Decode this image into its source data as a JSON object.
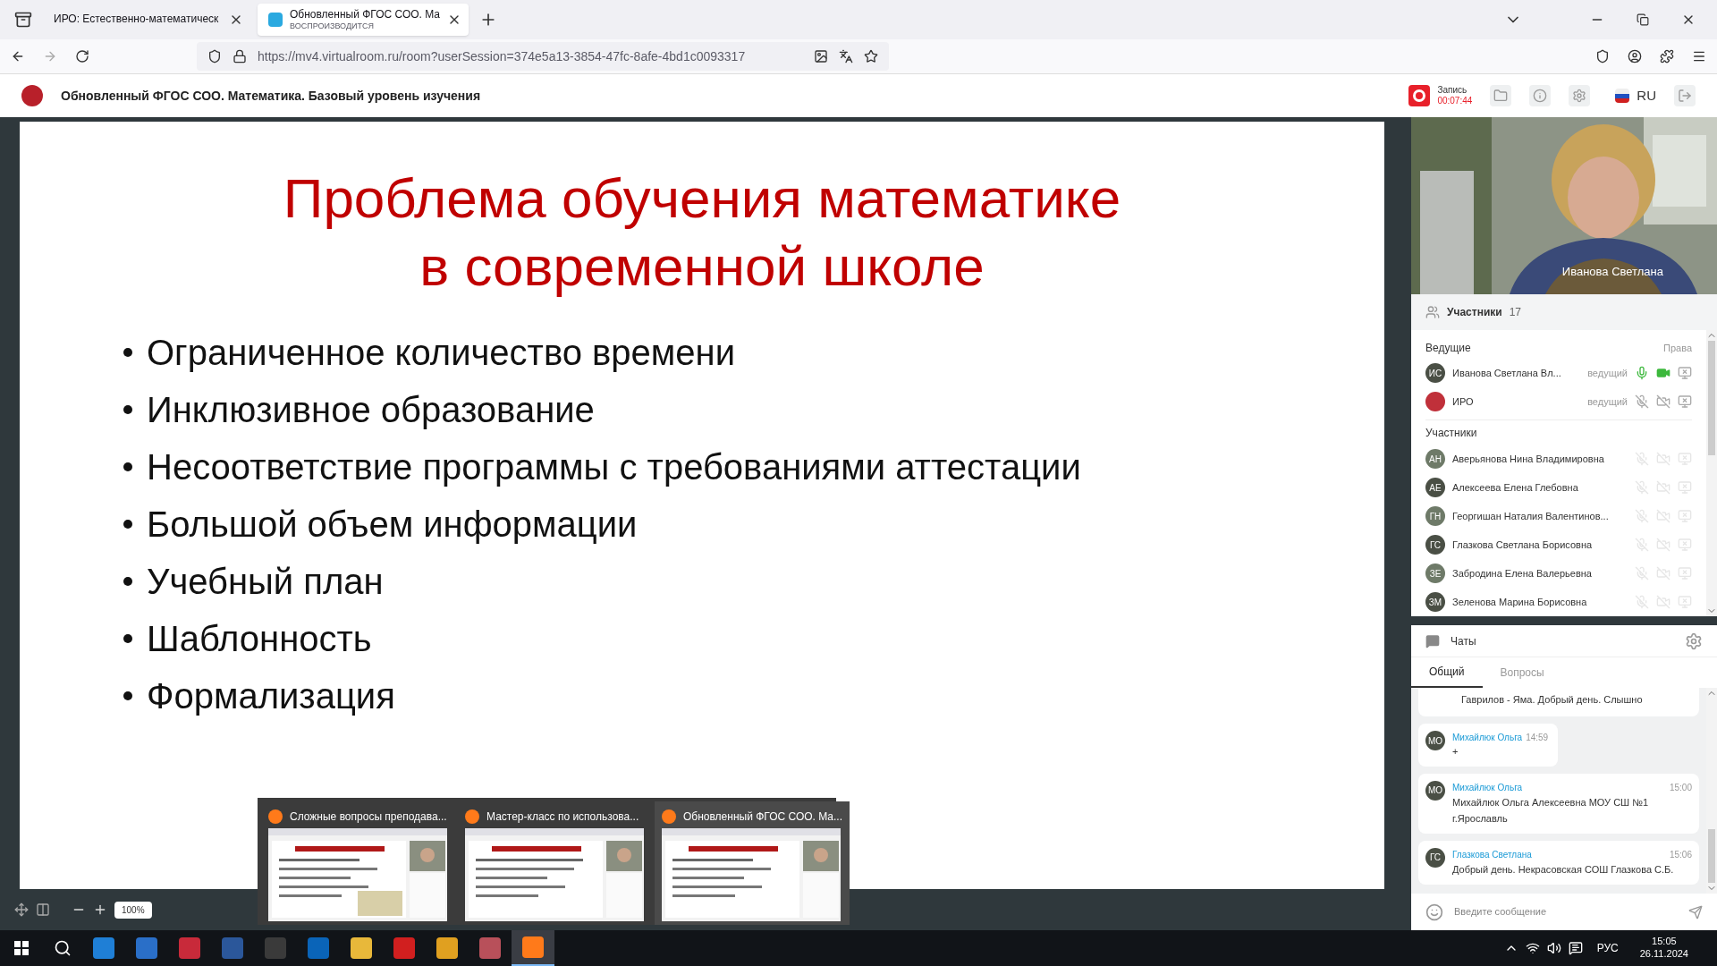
{
  "browser": {
    "tabs": [
      {
        "label": "ИРО: Естественно-математическ",
        "selected": false
      },
      {
        "label": "Обновленный ФГОС СОО. Ма",
        "subtitle": "ВОСПРОИЗВОДИТСЯ",
        "selected": true
      }
    ],
    "url": "https://mv4.virtualroom.ru/room?userSession=374e5a13-3854-47fc-8afe-4bd1c0093317"
  },
  "app_header": {
    "title": "Обновленный ФГОС СОО. Математика. Базовый уровень изучения",
    "record_label": "Запись",
    "record_time": "00:07:44",
    "language": "RU"
  },
  "slide": {
    "title_lines": [
      "Проблема обучения математике",
      "в современной школе"
    ],
    "bullets": [
      "Ограниченное количество времени",
      "Инклюзивное образование",
      "Несоответствие программы с требованиями аттестации",
      "Большой объем информации",
      "Учебный план",
      "Шаблонность",
      "Формализация"
    ]
  },
  "zoom": {
    "value": "100%"
  },
  "window_previews": [
    {
      "title": "Сложные вопросы преподава...",
      "selected": false
    },
    {
      "title": "Мастер-класс по использова...",
      "selected": false
    },
    {
      "title": "Обновленный ФГОС СОО. Ма...",
      "selected": true
    }
  ],
  "video": {
    "name": "Иванова Светлана"
  },
  "participants": {
    "title": "Участники",
    "count": "17",
    "hosts_heading": "Ведущие",
    "rights": "Права",
    "hosts": [
      {
        "kind": "initials",
        "initials": "ИС",
        "name": "Иванова Светлана Вл...",
        "role": "ведущий",
        "mic": true,
        "camera": true
      },
      {
        "kind": "logo",
        "name": "ИРО",
        "role": "ведущий",
        "mic": false,
        "camera": false
      }
    ],
    "members_heading": "Участники",
    "members": [
      {
        "initials": "АН",
        "name": "Аверьянова Нина Владимировна"
      },
      {
        "initials": "АЕ",
        "name": "Алексеева Елена Глебовна"
      },
      {
        "initials": "ГН",
        "name": "Георгишан Наталия Валентинов..."
      },
      {
        "initials": "ГС",
        "name": "Глазкова Светлана Борисовна"
      },
      {
        "initials": "ЗЕ",
        "name": "Забродина Елена Валерьевна"
      },
      {
        "initials": "ЗМ",
        "name": "Зеленова Марина Борисовна"
      }
    ]
  },
  "chat": {
    "title": "Чаты",
    "tabs": [
      {
        "label": "Общий",
        "selected": true
      },
      {
        "label": "Вопросы",
        "selected": false
      }
    ],
    "messages": [
      {
        "kind": "partial",
        "text": "Гаврилов - Яма. Добрый день. Слышно"
      },
      {
        "kind": "inline",
        "initials": "МО",
        "author": "Михайлюк Ольга",
        "time": "14:59",
        "text": "+"
      },
      {
        "kind": "wide",
        "initials": "МО",
        "author": "Михайлюк Ольга",
        "time": "15:00",
        "text": "Михайлюк Ольга Алексеевна МОУ СШ №1 г.Ярославль"
      },
      {
        "kind": "wide",
        "initials": "ГС",
        "author": "Глазкова Светлана",
        "time": "15:06",
        "text": "Добрый день. Некрасовская СОШ Глазкова С.Б."
      }
    ],
    "placeholder": "Введите сообщение"
  },
  "taskbar": {
    "apps": [
      {
        "selected": false
      },
      {
        "selected": false
      },
      {
        "selected": false
      },
      {
        "selected": false
      },
      {
        "selected": false
      },
      {
        "selected": false
      },
      {
        "selected": false
      },
      {
        "selected": false
      },
      {
        "selected": false
      },
      {
        "selected": false
      },
      {
        "selected": true
      }
    ],
    "language": "РУС",
    "time": "15:05",
    "date": "26.11.2024"
  }
}
